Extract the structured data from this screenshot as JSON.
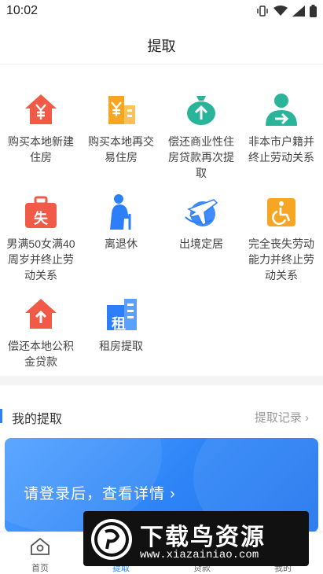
{
  "status_bar": {
    "time": "10:02"
  },
  "nav": {
    "title": "提取"
  },
  "grid": {
    "items": [
      {
        "label": "购买本地新建住房",
        "icon": "house-yuan-icon"
      },
      {
        "label": "购买本地再交易住房",
        "icon": "building-yuan-icon"
      },
      {
        "label": "偿还商业性住房贷款再次提取",
        "icon": "money-bag-up-icon"
      },
      {
        "label": "非本市户籍并终止劳动关系",
        "icon": "person-arrow-icon"
      },
      {
        "label": "男满50女满40周岁并终止劳动关系",
        "icon": "briefcase-lost-icon"
      },
      {
        "label": "离退休",
        "icon": "elder-cane-icon"
      },
      {
        "label": "出境定居",
        "icon": "airplane-globe-icon"
      },
      {
        "label": "完全丧失劳动能力并终止劳动关系",
        "icon": "wheelchair-icon"
      },
      {
        "label": "偿还本地公积金贷款",
        "icon": "house-up-icon"
      },
      {
        "label": "租房提取",
        "icon": "rent-building-icon"
      }
    ],
    "briefcase_char": "失",
    "rent_char": "租"
  },
  "section": {
    "title": "我的提取",
    "link": "提取记录 ›"
  },
  "login_card": {
    "text": "请登录后，查看详情 ›"
  },
  "tabs": [
    {
      "label": "首页",
      "icon": "home-icon"
    },
    {
      "label": "提取",
      "icon": "withdraw-icon"
    },
    {
      "label": "贷款",
      "icon": "loan-icon"
    },
    {
      "label": "我的",
      "icon": "profile-icon"
    }
  ],
  "watermark": {
    "title": "下载鸟资源",
    "url": "www.xiazainiao.com"
  },
  "colors": {
    "red": "#f05a47",
    "orange": "#f7a623",
    "teal": "#2ab59a",
    "blue": "#2d7ff9",
    "gray_text": "#999999"
  }
}
